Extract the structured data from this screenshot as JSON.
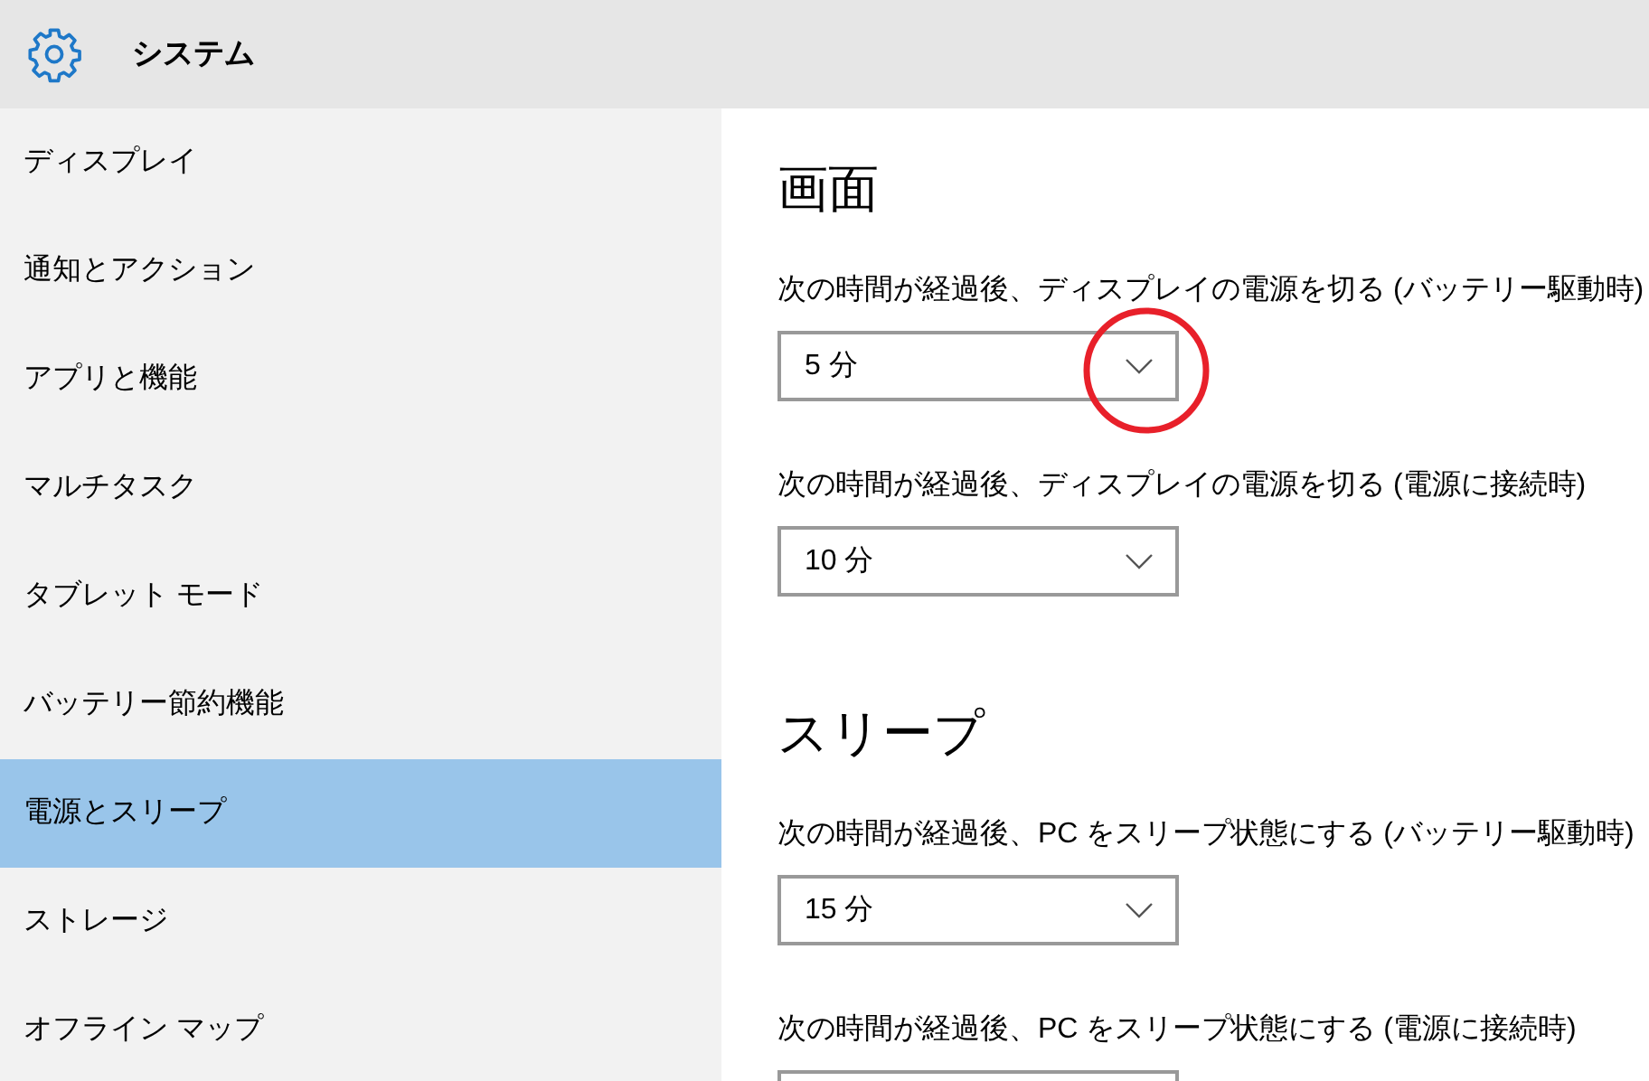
{
  "header": {
    "title": "システム"
  },
  "sidebar": {
    "items": [
      {
        "label": "ディスプレイ",
        "selected": false
      },
      {
        "label": "通知とアクション",
        "selected": false
      },
      {
        "label": "アプリと機能",
        "selected": false
      },
      {
        "label": "マルチタスク",
        "selected": false
      },
      {
        "label": "タブレット モード",
        "selected": false
      },
      {
        "label": "バッテリー節約機能",
        "selected": false
      },
      {
        "label": "電源とスリープ",
        "selected": true
      },
      {
        "label": "ストレージ",
        "selected": false
      },
      {
        "label": "オフライン マップ",
        "selected": false
      }
    ]
  },
  "sections": [
    {
      "heading": "画面",
      "settings": [
        {
          "label": "次の時間が経過後、ディスプレイの電源を切る (バッテリー駆動時)",
          "value": "5 分",
          "annotated": true
        },
        {
          "label": "次の時間が経過後、ディスプレイの電源を切る (電源に接続時)",
          "value": "10 分",
          "annotated": false
        }
      ]
    },
    {
      "heading": "スリープ",
      "settings": [
        {
          "label": "次の時間が経過後、PC をスリープ状態にする (バッテリー駆動時)",
          "value": "15 分",
          "annotated": false
        },
        {
          "label": "次の時間が経過後、PC をスリープ状態にする (電源に接続時)",
          "annotated": false
        }
      ]
    }
  ]
}
